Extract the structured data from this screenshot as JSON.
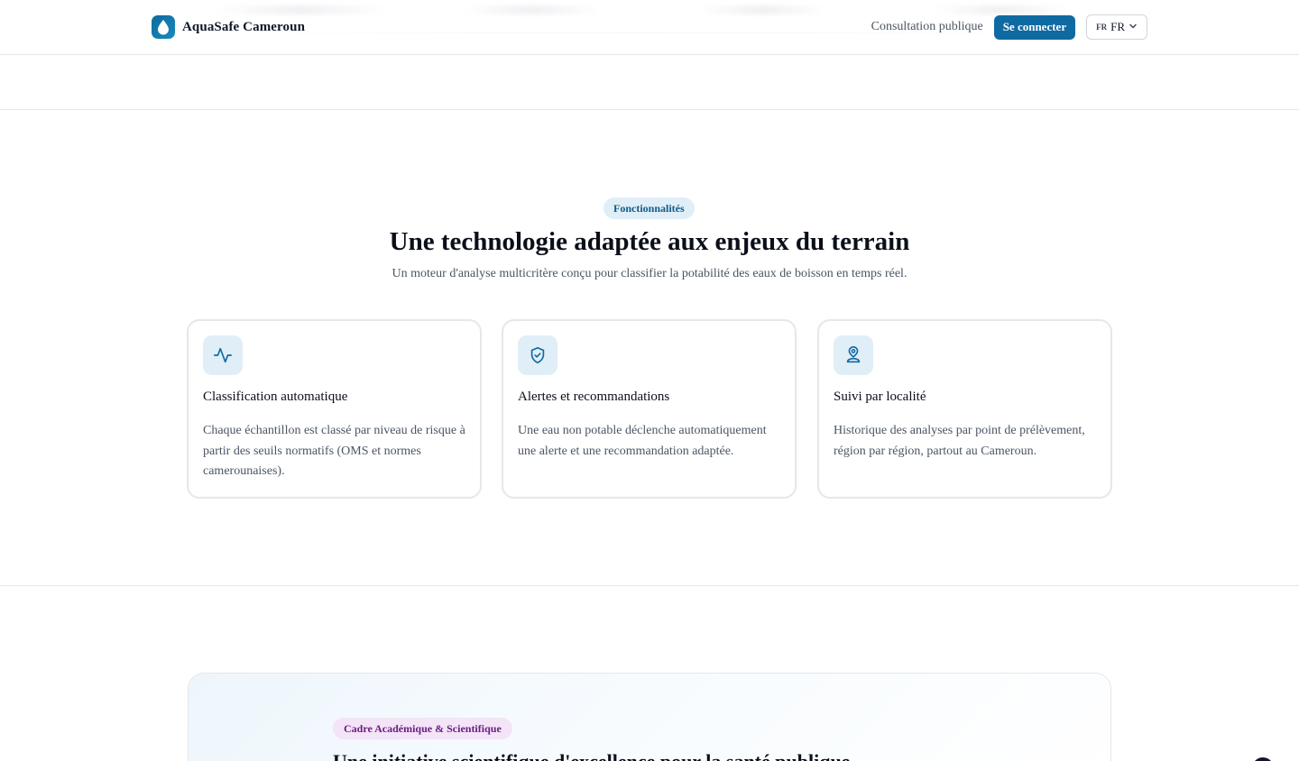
{
  "header": {
    "brand_name": "AquaSafe Cameroun",
    "nav_link": "Consultation publique",
    "login_button": "Se connecter",
    "lang_code": "FR",
    "lang_label": "FR"
  },
  "features": {
    "badge": "Fonctionnalités",
    "title": "Une technologie adaptée aux enjeux du terrain",
    "subtitle": "Un moteur d'analyse multicritère conçu pour classifier la potabilité des eaux de boisson en temps réel.",
    "cards": [
      {
        "icon": "activity-icon",
        "title": "Classification automatique",
        "text": "Chaque échantillon est classé par niveau de risque à partir des seuils normatifs (OMS et normes camerounaises)."
      },
      {
        "icon": "shield-check-icon",
        "title": "Alertes et recommandations",
        "text": "Une eau non potable déclenche automatiquement une alerte et une recommandation adaptée."
      },
      {
        "icon": "user-pin-icon",
        "title": "Suivi par localité",
        "text": "Historique des analyses par point de prélèvement, région par région, partout au Cameroun."
      }
    ]
  },
  "academic": {
    "badge": "Cadre Académique & Scientifique",
    "title": "Une initiative scientifique d'excellence pour la santé publique"
  },
  "colors": {
    "primary": "#0f6aa2",
    "badge_bg": "#e0eef7",
    "academic_badge_bg": "#f3e4f7",
    "academic_badge_text": "#6b1e84"
  }
}
